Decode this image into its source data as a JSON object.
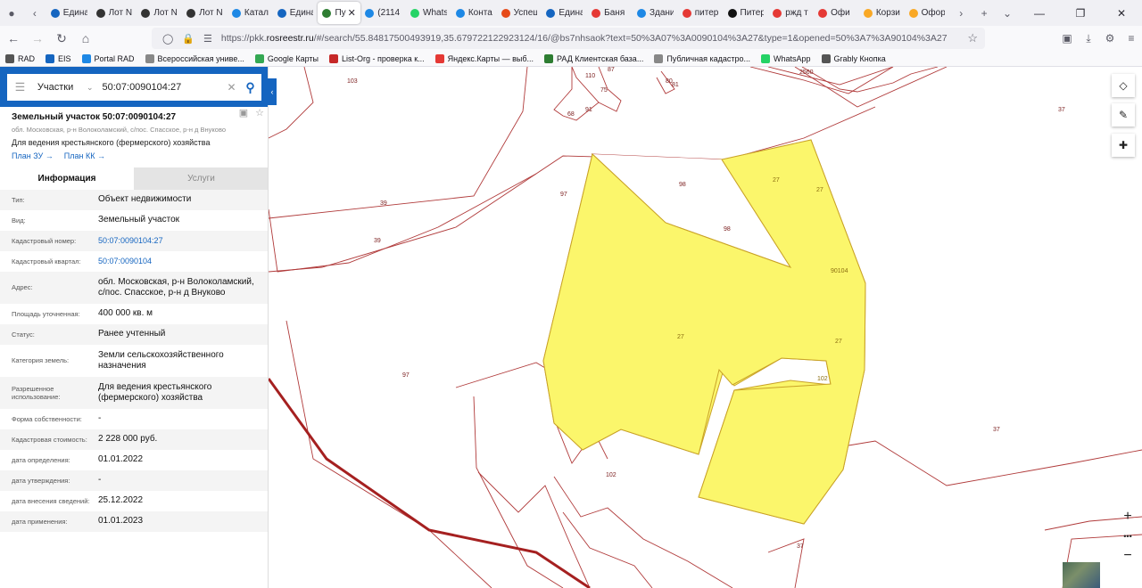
{
  "browser": {
    "tabs": [
      {
        "label": "Едина",
        "color": "#1565c0"
      },
      {
        "label": "Лот N",
        "color": "#333333"
      },
      {
        "label": "Лот N",
        "color": "#333333"
      },
      {
        "label": "Лот N",
        "color": "#333333"
      },
      {
        "label": "Катал",
        "color": "#1e88e5"
      },
      {
        "label": "Едина",
        "color": "#1565c0"
      },
      {
        "label": "Пу",
        "color": "#2e7d32",
        "active": true
      },
      {
        "label": "(2114",
        "color": "#1e88e5"
      },
      {
        "label": "Whats",
        "color": "#25d366"
      },
      {
        "label": "Конта",
        "color": "#1e88e5"
      },
      {
        "label": "Успеш",
        "color": "#e64a19"
      },
      {
        "label": "Едина",
        "color": "#1565c0"
      },
      {
        "label": "Баня",
        "color": "#e53935"
      },
      {
        "label": "Здани",
        "color": "#1e88e5"
      },
      {
        "label": "питер",
        "color": "#e53935"
      },
      {
        "label": "Питер воспл",
        "color": "#111111"
      },
      {
        "label": "ржд т",
        "color": "#e53935"
      },
      {
        "label": "Офи",
        "color": "#e53935"
      },
      {
        "label": "Корзи",
        "color": "#f9a825"
      },
      {
        "label": "Офор",
        "color": "#f9a825"
      }
    ],
    "url_prefix": "https://pkk.",
    "url_host": "rosreestr.ru",
    "url_rest": "/#/search/55.84817500493919,35.679722122923124/16/@bs7nhsaok?text=50%3A07%3A0090104%3A27&type=1&opened=50%3A7%3A90104%3A27",
    "bookmarks": [
      {
        "label": "RAD",
        "color": "#555555"
      },
      {
        "label": "EIS",
        "color": "#1565c0"
      },
      {
        "label": "Portal RAD",
        "color": "#1e88e5"
      },
      {
        "label": "Всероссийская униве...",
        "color": "#888888"
      },
      {
        "label": "Google Карты",
        "color": "#34a853"
      },
      {
        "label": "List-Org - проверка к...",
        "color": "#c62828"
      },
      {
        "label": "Яндекс.Карты — выб...",
        "color": "#e53935"
      },
      {
        "label": "РАД Клиентская база...",
        "color": "#2e7d32"
      },
      {
        "label": "Публичная кадастро...",
        "color": "#888888"
      },
      {
        "label": "WhatsApp",
        "color": "#25d366"
      },
      {
        "label": "Grably Кнопка",
        "color": "#555555"
      }
    ]
  },
  "search": {
    "category": "Участки",
    "query": "50:07:0090104:27"
  },
  "parcel": {
    "title": "Земельный участок 50:07:0090104:27",
    "address_short": "обл. Московская, р-н Волоколамский, с/пос. Спасское, р-н д Внуково",
    "usage": "Для ведения крестьянского (фермерского) хозяйства",
    "link_plan_zu": "План ЗУ",
    "link_plan_kk": "План КК",
    "tab_info": "Информация",
    "tab_services": "Услуги",
    "rows": [
      {
        "label": "Тип:",
        "value": "Объект недвижимости"
      },
      {
        "label": "Вид:",
        "value": "Земельный участок"
      },
      {
        "label": "Кадастровый номер:",
        "value": "50:07:0090104:27",
        "link": true
      },
      {
        "label": "Кадастровый квартал:",
        "value": "50:07:0090104",
        "link": true
      },
      {
        "label": "Адрес:",
        "value": "обл. Московская, р-н Волоколамский, с/пос. Спасское, р-н д Внуково"
      },
      {
        "label": "Площадь уточненная:",
        "value": "400 000 кв. м"
      },
      {
        "label": "Статус:",
        "value": "Ранее учтенный"
      },
      {
        "label": "Категория земель:",
        "value": "Земли сельскохозяйственного назначения"
      },
      {
        "label": "Разрешенное использование:",
        "value": "Для ведения крестьянского (фермерского) хозяйства"
      },
      {
        "label": "Форма собственности:",
        "value": "-"
      },
      {
        "label": "Кадастровая стоимость:",
        "value": "2 228 000 руб."
      },
      {
        "label": "дата определения:",
        "value": "01.01.2022"
      },
      {
        "label": "дата утверждения:",
        "value": "-"
      },
      {
        "label": "дата внесения сведений:",
        "value": "25.12.2022"
      },
      {
        "label": "дата применения:",
        "value": "01.01.2023"
      }
    ]
  },
  "map": {
    "labels": [
      "103",
      "87",
      "110",
      "75",
      "80",
      "81",
      "2560",
      "37",
      "68",
      "91",
      "97",
      "98",
      "98",
      "27",
      "27",
      "39",
      "39",
      "90104",
      "27",
      "27",
      "102",
      "97",
      "102",
      "37",
      "37"
    ],
    "selected_fill": "#fbf66b",
    "selected_stroke": "#c9a227",
    "road_color": "#a52020",
    "zoom_in": "+",
    "zoom_more": "•••",
    "zoom_out": "−"
  }
}
